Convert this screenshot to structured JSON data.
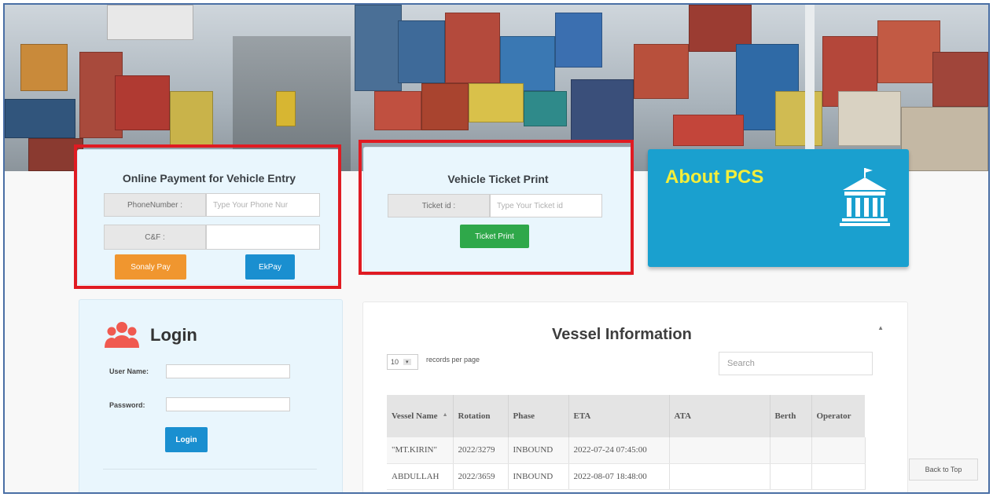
{
  "payment": {
    "title": "Online Payment for Vehicle Entry",
    "phone_label": "PhoneNumber :",
    "phone_placeholder": "Type Your Phone Nur",
    "cf_label": "C&F :",
    "cf_value": "",
    "sonaly_label": "Sonaly Pay",
    "ekpay_label": "EkPay"
  },
  "ticket": {
    "title": "Vehicle Ticket Print",
    "ticket_label": "Ticket id :",
    "ticket_placeholder": "Type Your Ticket id",
    "print_label": "Ticket Print"
  },
  "about": {
    "title": "About PCS",
    "icon": "bank-building-icon"
  },
  "login": {
    "title": "Login",
    "icon": "users-group-icon",
    "username_label": "User Name:",
    "password_label": "Password:",
    "button_label": "Login"
  },
  "vessel": {
    "title": "Vessel Information",
    "page_size": "10",
    "records_label": "records per page",
    "search_placeholder": "Search",
    "columns": [
      "Vessel Name",
      "Rotation",
      "Phase",
      "ETA",
      "ATA",
      "Berth",
      "Operator"
    ],
    "rows": [
      [
        "\"MT.KIRIN\"",
        "2022/3279",
        "INBOUND",
        "2022-07-24 07:45:00",
        "",
        "",
        ""
      ],
      [
        "ABDULLAH",
        "2022/3659",
        "INBOUND",
        "2022-08-07 18:48:00",
        "",
        "",
        ""
      ]
    ]
  },
  "back_to_top": "Back to Top",
  "colors": {
    "highlight": "#e01b22",
    "sonaly": "#f0962f",
    "ekpay": "#1a8fd0",
    "ticket_print": "#2fa84a",
    "about_bg": "#1aa0cf",
    "about_title": "#f4ee3a",
    "login_btn": "#1a8fd0",
    "users_icon": "#f05a50"
  }
}
